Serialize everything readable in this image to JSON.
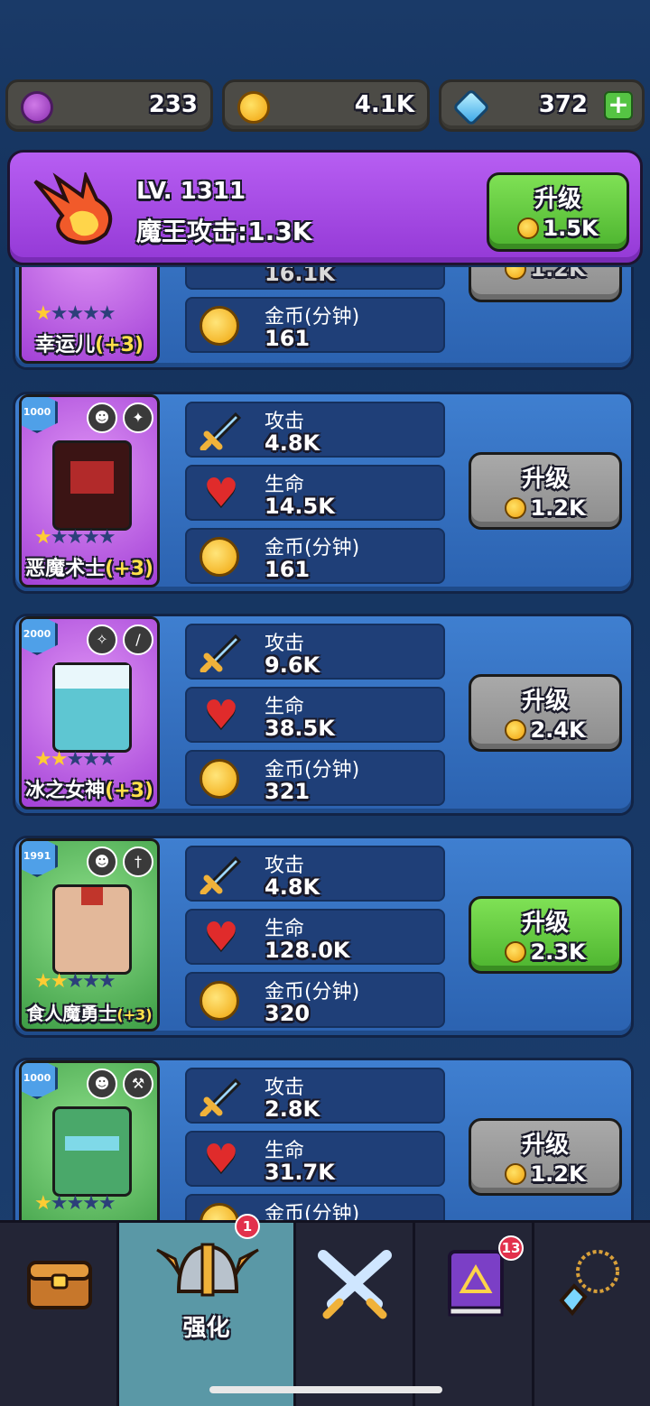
{
  "currencies": {
    "orb": "233",
    "gold": "4.1K",
    "gems": "372",
    "plus": "+"
  },
  "banner": {
    "level": "LV. 1311",
    "attack": "魔王攻击:1.3K",
    "upgrade_label": "升级",
    "upgrade_cost": "1.5K"
  },
  "partial_card": {
    "partial_value": "16.1K",
    "name": "幸运儿",
    "bonus": "(+3)",
    "stars_on": "★",
    "stars_off": "★★★★",
    "gold_label": "金币(分钟)",
    "gold_value": "161",
    "upgrade_cost": "1.2K"
  },
  "labels": {
    "attack": "攻击",
    "hp": "生命",
    "gold": "金币(分钟)",
    "upgrade": "升级"
  },
  "heroes": [
    {
      "tier": "1000",
      "name": "恶魔术士",
      "bonus": "(+3)",
      "stars_on": "★",
      "stars_off": "★★★★",
      "attack": "4.8K",
      "hp": "14.5K",
      "gold": "161",
      "cost": "1.2K",
      "button": "gray"
    },
    {
      "tier": "2000",
      "name": "冰之女神",
      "bonus": "(+3)",
      "stars_on": "★★",
      "stars_off": "★★★",
      "attack": "9.6K",
      "hp": "38.5K",
      "gold": "321",
      "cost": "2.4K",
      "button": "gray"
    },
    {
      "tier": "1991",
      "name": "食人魔勇士",
      "bonus": "(+3)",
      "stars_on": "★★",
      "stars_off": "★★★",
      "attack": "4.8K",
      "hp": "128.0K",
      "gold": "320",
      "cost": "2.3K",
      "button": "green"
    },
    {
      "tier": "1000",
      "name": "",
      "bonus": "",
      "stars_on": "★",
      "stars_off": "★★★★",
      "attack": "2.8K",
      "hp": "31.7K",
      "gold": "",
      "cost": "1.2K",
      "button": "gray"
    }
  ],
  "nav": {
    "enhance_label": "强化",
    "enhance_badge": "1",
    "book_badge": "13"
  },
  "icons": {
    "treasure": "treasure-chest-icon",
    "helmet": "winged-helmet-icon",
    "swords": "crossed-swords-icon",
    "book": "spell-book-icon",
    "amulet": "amulet-icon"
  }
}
